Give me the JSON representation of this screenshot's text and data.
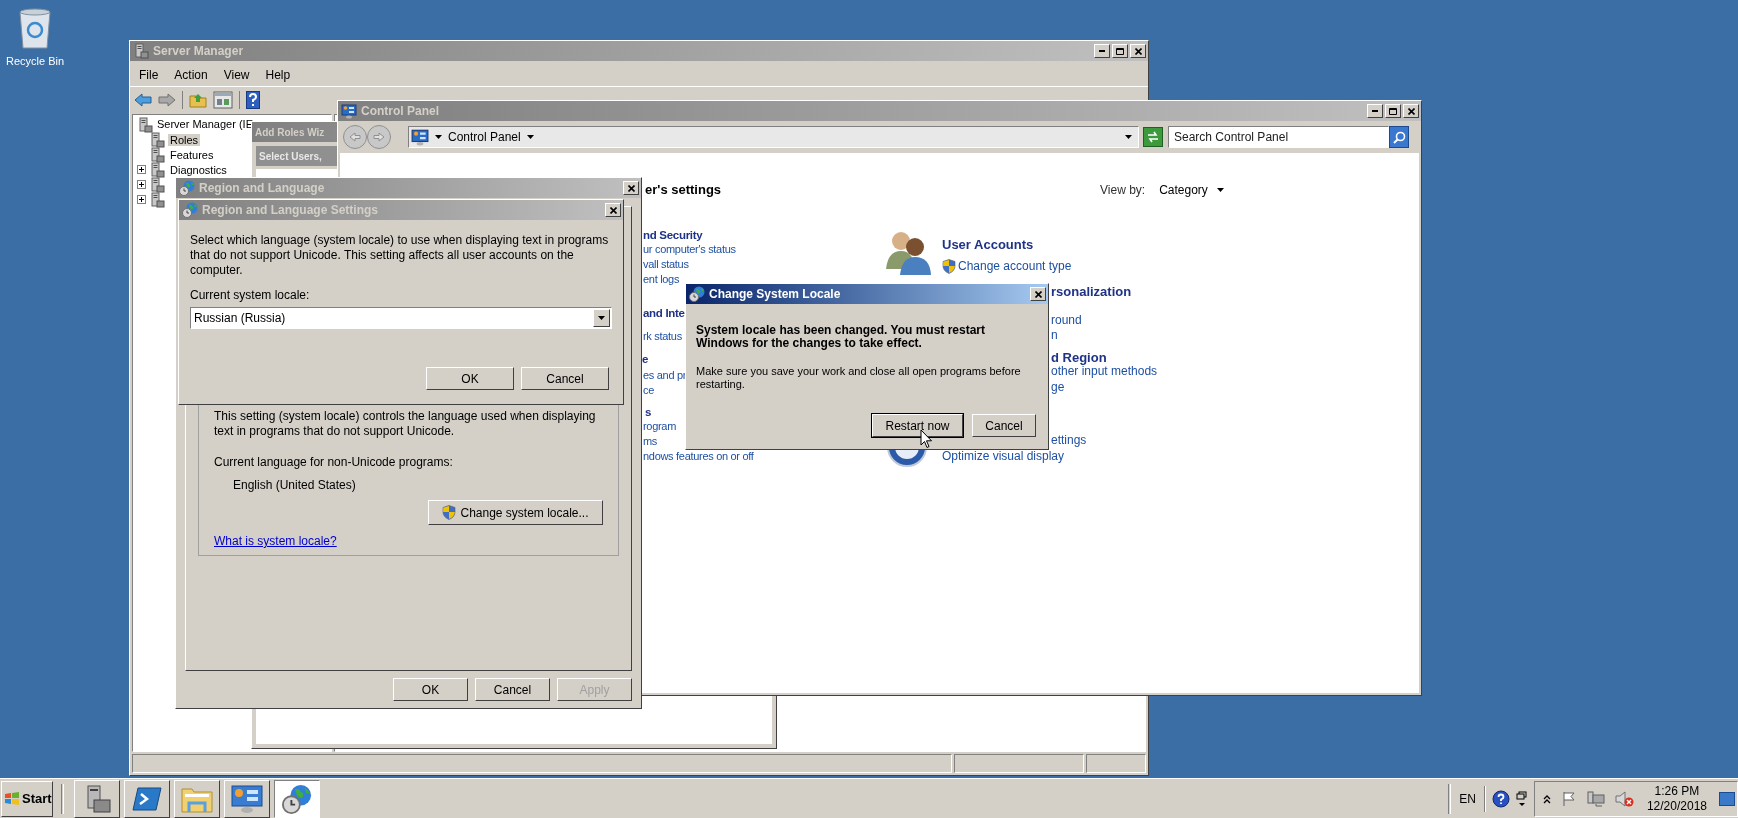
{
  "desktop_icons": [
    {
      "label": "Recycle Bin"
    }
  ],
  "server_manager": {
    "title": "Server Manager",
    "active": false,
    "kind": "main",
    "menu": [
      "File",
      "Action",
      "View",
      "Help"
    ],
    "tree": {
      "label": "Server Manager (IE",
      "children": [
        {
          "label": "Roles",
          "selected": true,
          "kind": "leaf"
        },
        {
          "label": "Features",
          "selected": false,
          "kind": "leaf"
        },
        {
          "label": "Diagnostics",
          "selected": false,
          "kind": "group",
          "expanded": false
        },
        {
          "selected": false,
          "kind": "group",
          "expanded": false
        },
        {
          "selected": false,
          "kind": "group",
          "expanded": false
        }
      ]
    }
  },
  "add_roles_wizard": {
    "title": "Add Roles Wiz",
    "active": false,
    "header": "Select Users,"
  },
  "control_panel": {
    "title": "Control Panel",
    "active": false,
    "kind": "main",
    "breadcrumb": "Control Panel",
    "search": {
      "placeholder": "Search Control Panel"
    },
    "heading": "er's settings",
    "view_by": {
      "label": "View by:",
      "value": "Category"
    },
    "left_column": [
      {
        "kind": "heading",
        "text": "nd Security"
      },
      {
        "kind": "link",
        "text": "ur computer's status"
      },
      {
        "kind": "link",
        "text": "vall status"
      },
      {
        "kind": "link",
        "text": "ent logs"
      },
      {
        "kind": "heading",
        "text": "and Inte"
      },
      {
        "kind": "link",
        "text": "rk status"
      },
      {
        "kind": "heading",
        "text": "e"
      },
      {
        "kind": "link",
        "text": "es and pr"
      },
      {
        "kind": "link",
        "text": "ce"
      },
      {
        "kind": "heading",
        "text": "s"
      },
      {
        "kind": "link",
        "text": "rogram"
      },
      {
        "kind": "link",
        "text": "ms"
      },
      {
        "kind": "link",
        "text": "ndows features on or off"
      }
    ],
    "right_column": [
      {
        "kind": "heading",
        "text": "User Accounts"
      },
      {
        "kind": "shield_link",
        "text": "Change account type"
      },
      {
        "kind": "heading",
        "text": "rsonalization"
      },
      {
        "kind": "link",
        "text": "round"
      },
      {
        "kind": "link",
        "text": "n"
      },
      {
        "kind": "heading",
        "text": "d Region"
      },
      {
        "kind": "link",
        "text": "other input methods"
      },
      {
        "kind": "link",
        "text": "ge"
      },
      {
        "kind": "link",
        "text": "ettings"
      },
      {
        "kind": "link",
        "text": "Optimize visual display"
      }
    ]
  },
  "region_and_language": {
    "title": "Region and Language",
    "active": false,
    "kind": "dialog",
    "description": "This setting (system locale) controls the language used when displaying text in programs that do not support Unicode.",
    "current_label": "Current language for non-Unicode programs:",
    "current_value": "English (United States)",
    "change_button": "Change system locale...",
    "help_link": "What is system locale?",
    "buttons": [
      {
        "label": "OK",
        "disabled": false
      },
      {
        "label": "Cancel",
        "disabled": false
      },
      {
        "label": "Apply",
        "disabled": true
      }
    ]
  },
  "region_settings": {
    "title": "Region and Language Settings",
    "active": false,
    "kind": "dialog",
    "description": "Select which language (system locale) to use when displaying text in programs that do not support Unicode. This setting affects all user accounts on the computer.",
    "locale_label": "Current system locale:",
    "locale": {
      "value": "Russian (Russia)"
    },
    "buttons": [
      {
        "label": "OK",
        "default": false
      },
      {
        "label": "Cancel",
        "default": false
      }
    ]
  },
  "change_system_locale": {
    "title": "Change System Locale",
    "active": true,
    "kind": "dialog",
    "message": "System locale has been changed. You must restart Windows for the changes to take effect.",
    "note": "Make sure you save your work and close all open programs before restarting.",
    "buttons": [
      {
        "label": "Restart now",
        "default": true
      },
      {
        "label": "Cancel",
        "default": false
      }
    ]
  },
  "taskbar": {
    "start": "Start",
    "apps": [
      {
        "kind": "server",
        "selected": false
      },
      {
        "kind": "terminal",
        "selected": false
      },
      {
        "kind": "folder",
        "selected": false
      },
      {
        "kind": "control",
        "selected": false
      },
      {
        "kind": "globe",
        "selected": true
      }
    ],
    "language": "EN",
    "time": "1:26 PM",
    "date": "12/20/2018"
  }
}
